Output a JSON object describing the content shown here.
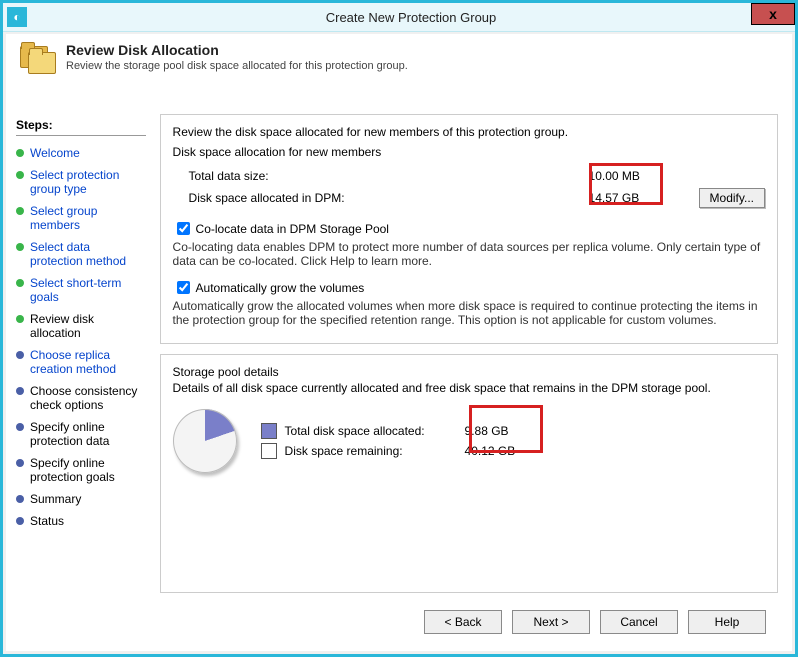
{
  "window": {
    "title": "Create New Protection Group",
    "close_glyph": "x"
  },
  "header": {
    "title": "Review Disk Allocation",
    "subtitle": "Review the storage pool disk space allocated for this protection group."
  },
  "steps": {
    "heading": "Steps:",
    "items": [
      {
        "label": "Welcome",
        "state": "done"
      },
      {
        "label": "Select protection group type",
        "state": "done"
      },
      {
        "label": "Select group members",
        "state": "done"
      },
      {
        "label": "Select data protection method",
        "state": "done"
      },
      {
        "label": "Select short-term goals",
        "state": "done"
      },
      {
        "label": "Review disk allocation",
        "state": "current"
      },
      {
        "label": "Choose replica creation method",
        "state": "pending_link"
      },
      {
        "label": "Choose consistency check options",
        "state": "future"
      },
      {
        "label": "Specify online protection data",
        "state": "future"
      },
      {
        "label": "Specify online protection goals",
        "state": "future"
      },
      {
        "label": "Summary",
        "state": "future"
      },
      {
        "label": "Status",
        "state": "future"
      }
    ]
  },
  "allocation": {
    "intro": "Review the disk space allocated for new members of this protection group.",
    "section_label": "Disk space allocation for new members",
    "total_data_label": "Total data size:",
    "total_data_value": "10.00 MB",
    "dpm_alloc_label": "Disk space allocated in DPM:",
    "dpm_alloc_value": "14.57 GB",
    "modify_label": "Modify...",
    "colocate_label": "Co-locate data in DPM Storage Pool",
    "colocate_desc": "Co-locating data enables DPM to protect more number of data sources per replica volume. Only certain type of data can be co-located. Click Help to learn more.",
    "autogrow_label": "Automatically grow the volumes",
    "autogrow_desc": "Automatically grow the allocated volumes when more disk space is required to continue protecting the items in the protection group for the specified retention range. This option is not applicable for custom volumes."
  },
  "pool": {
    "section_label": "Storage pool details",
    "desc": "Details of all disk space currently allocated and free disk space that remains in the DPM storage pool.",
    "allocated_label": "Total disk space allocated:",
    "allocated_value": "9.88 GB",
    "remaining_label": "Disk space remaining:",
    "remaining_value": "40.12 GB"
  },
  "chart_data": {
    "type": "pie",
    "title": "Storage pool details",
    "series": [
      {
        "name": "Total disk space allocated",
        "value": 9.88,
        "unit": "GB"
      },
      {
        "name": "Disk space remaining",
        "value": 40.12,
        "unit": "GB"
      }
    ]
  },
  "footer": {
    "back": "< Back",
    "next": "Next >",
    "cancel": "Cancel",
    "help": "Help"
  }
}
